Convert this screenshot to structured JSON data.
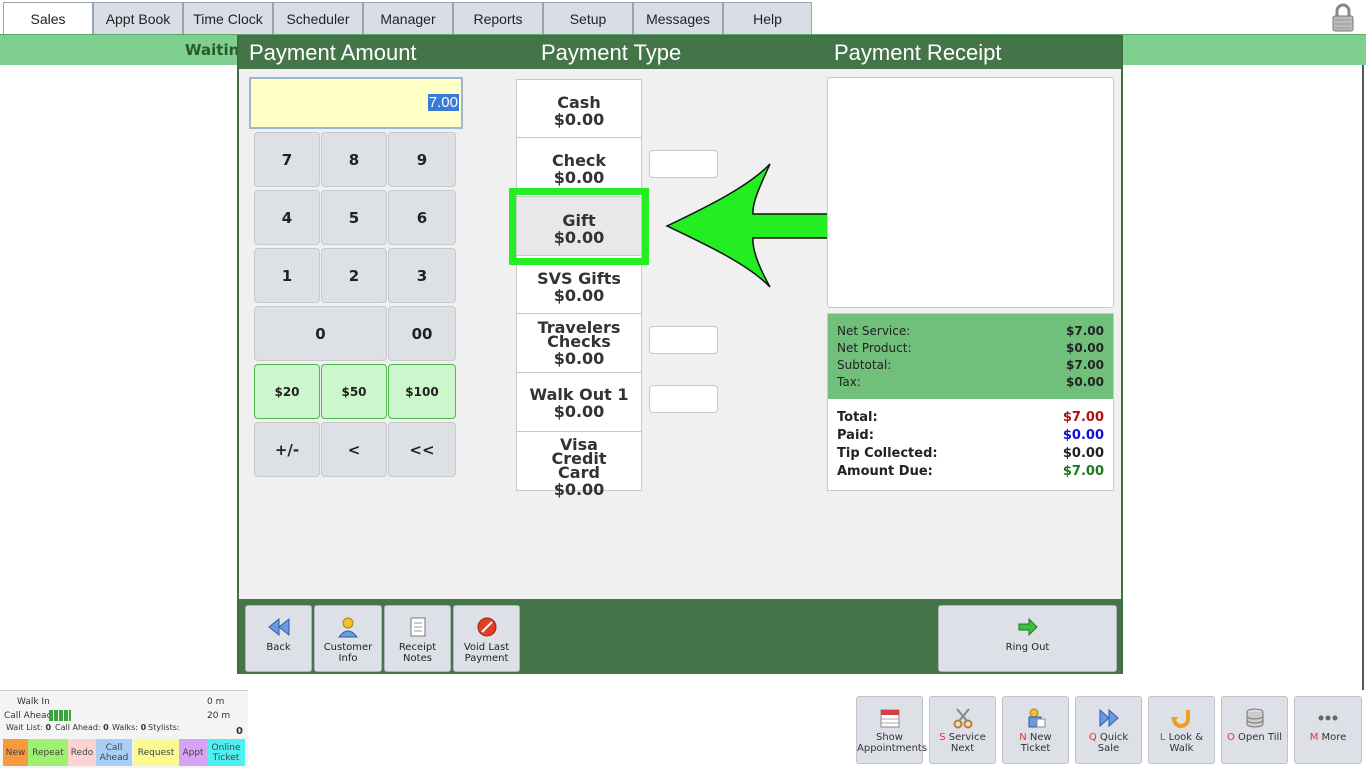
{
  "tabs": [
    "Sales",
    "Appt Book",
    "Time Clock",
    "Scheduler",
    "Manager",
    "Reports",
    "Setup",
    "Messages",
    "Help"
  ],
  "waiting_label": "Waitin",
  "dialog": {
    "amount_title": "Payment Amount",
    "type_title": "Payment Type",
    "receipt_title": "Payment Receipt",
    "amount_value": "7.00",
    "keypad": [
      "7",
      "8",
      "9",
      "4",
      "5",
      "6",
      "1",
      "2",
      "3",
      "0",
      "00",
      "$20",
      "$50",
      "$100",
      "+/-",
      "<",
      "<<"
    ],
    "payment_types": [
      {
        "name": "Cash",
        "amount": "$0.00"
      },
      {
        "name": "Check",
        "amount": "$0.00"
      },
      {
        "name": "Gift",
        "amount": "$0.00"
      },
      {
        "name": "SVS Gifts",
        "amount": "$0.00"
      },
      {
        "name": "Travelers Checks",
        "amount": "$0.00"
      },
      {
        "name": "Walk Out 1",
        "amount": "$0.00"
      },
      {
        "name": "Visa Credit Card",
        "amount": "$0.00"
      }
    ],
    "totals": {
      "net_service_label": "Net Service:",
      "net_service": "$7.00",
      "net_product_label": "Net Product:",
      "net_product": "$0.00",
      "subtotal_label": "Subtotal:",
      "subtotal": "$7.00",
      "tax_label": "Tax:",
      "tax": "$0.00",
      "total_label": "Total:",
      "total": "$7.00",
      "paid_label": "Paid:",
      "paid": "$0.00",
      "tip_label": "Tip Collected:",
      "tip": "$0.00",
      "due_label": "Amount Due:",
      "due": "$7.00"
    },
    "footer": {
      "back": "Back",
      "customer_info_1": "Customer",
      "customer_info_2": "Info",
      "receipt_notes_1": "Receipt",
      "receipt_notes_2": "Notes",
      "void_1": "Void Last",
      "void_2": "Payment",
      "ring_out": "Ring Out"
    }
  },
  "wait_panel": {
    "walk_in": "Walk In",
    "walk_in_time": "0 m",
    "call_ahead": "Call Ahead",
    "call_ahead_time": "20 m",
    "wait_list": "Wait List:",
    "wait_list_n": "0",
    "call_ahead_count": "Call Ahead:",
    "call_ahead_n": "0",
    "walks": "Walks:",
    "walks_n": "0",
    "stylists": "Stylists:",
    "stylists_n": "0",
    "tags": [
      "New",
      "Repeat",
      "Redo",
      "Call Ahead",
      "Request",
      "Appt",
      "Online Ticket"
    ]
  },
  "bottom_buttons": [
    {
      "key": "",
      "l1": "Show",
      "l2": "Appointments"
    },
    {
      "key": "S",
      "l1": "Service",
      "l2": "Next"
    },
    {
      "key": "N",
      "l1": "New",
      "l2": "Ticket"
    },
    {
      "key": "Q",
      "l1": "Quick",
      "l2": "Sale"
    },
    {
      "key": "L",
      "l1": "Look &",
      "l2": "Walk"
    },
    {
      "key": "O",
      "l1": "Open Till",
      "l2": ""
    },
    {
      "key": "M",
      "l1": "More",
      "l2": ""
    }
  ],
  "colors": {
    "header_green": "#447548",
    "highlight_green": "#22ee22",
    "total_red": "#b01010",
    "paid_blue": "#1010d0",
    "due_green": "#1a7a1a"
  }
}
